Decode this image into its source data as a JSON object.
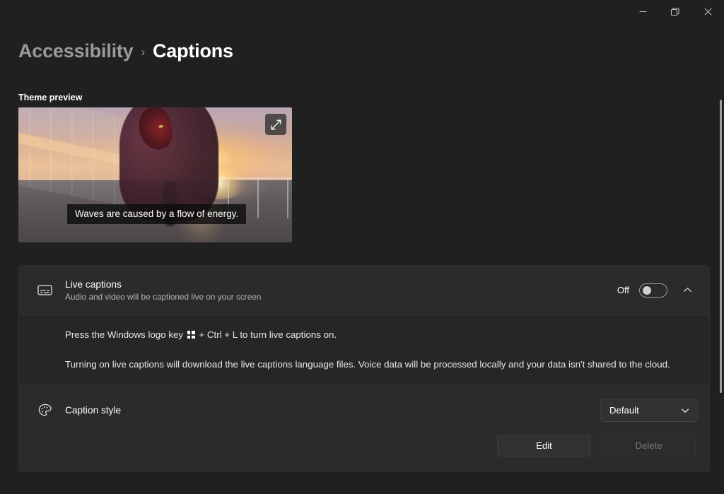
{
  "window": {
    "controls": [
      {
        "name": "minimize",
        "label": "Minimize"
      },
      {
        "name": "maximize",
        "label": "Restore"
      },
      {
        "name": "close",
        "label": "Close"
      }
    ]
  },
  "breadcrumb": {
    "parent": "Accessibility",
    "separator": "›",
    "current": "Captions"
  },
  "theme_preview": {
    "label": "Theme preview",
    "caption_text": "Waves are caused by a flow of energy.",
    "expand_icon": "expand-arrows-icon"
  },
  "live_captions": {
    "icon": "closed-caption-icon",
    "title": "Live captions",
    "subtitle": "Audio and video will be captioned live on your screen",
    "toggle_state": "Off",
    "toggle_on": false,
    "chevron": "chevron-up-icon",
    "expanded": true,
    "body_paragraph_1_before": "Press the Windows logo key",
    "body_paragraph_1_after": "+ Ctrl + L to turn live captions on.",
    "body_paragraph_2": "Turning on live captions will download the live captions language files. Voice data will be processed locally and your data isn't shared to the cloud."
  },
  "caption_style": {
    "icon": "palette-icon",
    "title": "Caption style",
    "dropdown_value": "Default",
    "dropdown_chevron": "chevron-down-icon",
    "edit_label": "Edit",
    "delete_label": "Delete",
    "delete_disabled": true
  },
  "colors": {
    "page_background": "#202020",
    "card_background": "#2b2b2b",
    "card_expand_background": "#262626",
    "text_primary": "#ffffff",
    "text_secondary": "#b4b4b4",
    "breadcrumb_parent": "#9a9a9a"
  }
}
